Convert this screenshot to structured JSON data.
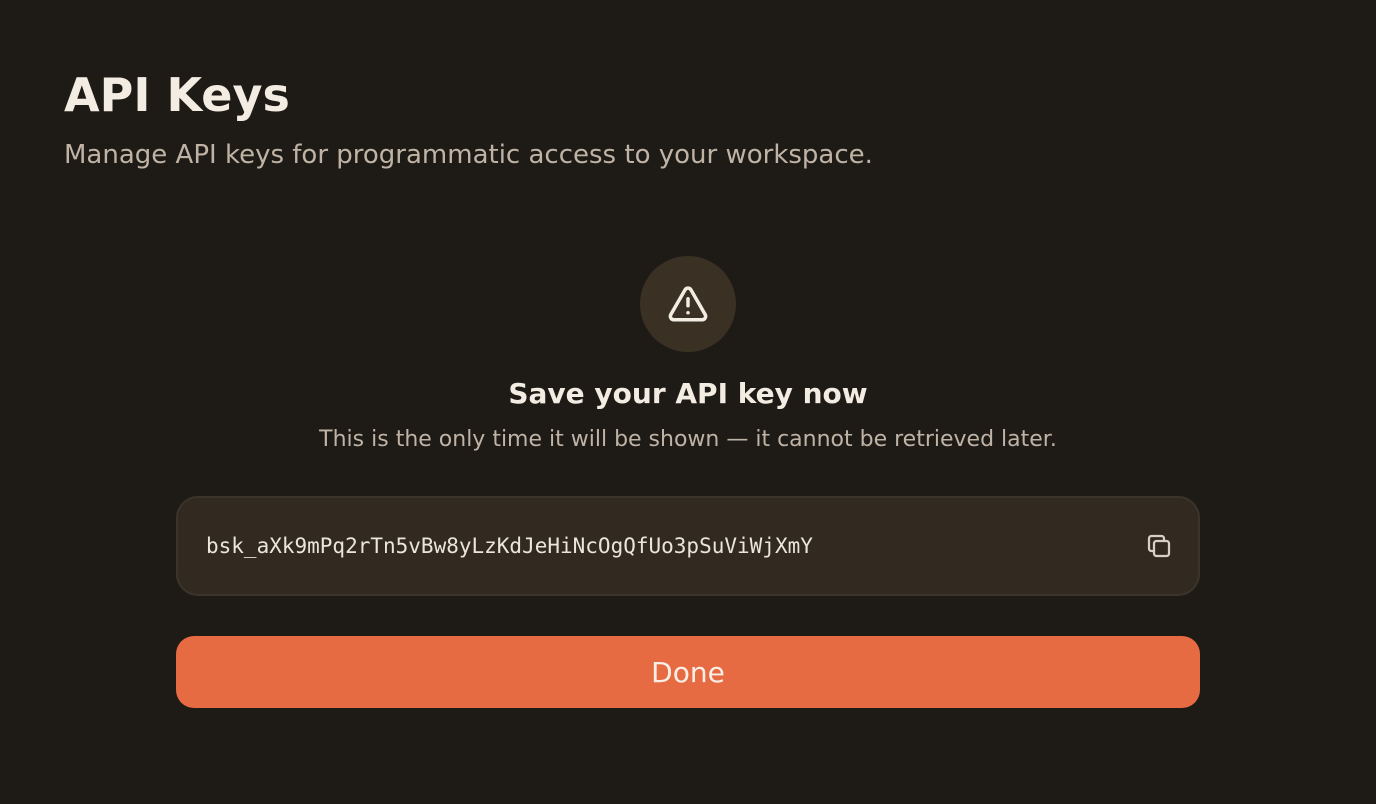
{
  "header": {
    "title": "API Keys",
    "subtitle": "Manage API keys for programmatic access to your workspace."
  },
  "notice": {
    "icon": "warning-triangle-icon",
    "title": "Save your API key now",
    "message": "This is the only time it will be shown — it cannot be retrieved later."
  },
  "key_field": {
    "value": "bsk_aXk9mPq2rTn5vBw8yLzKdJeHiNcOgQfUo3pSuViWjXmY",
    "copy_icon": "copy-icon"
  },
  "actions": {
    "done_label": "Done"
  },
  "colors": {
    "background": "#1e1b17",
    "accent": "#e76b42",
    "key_box": "#322a20",
    "icon_circle": "#3a3023"
  }
}
